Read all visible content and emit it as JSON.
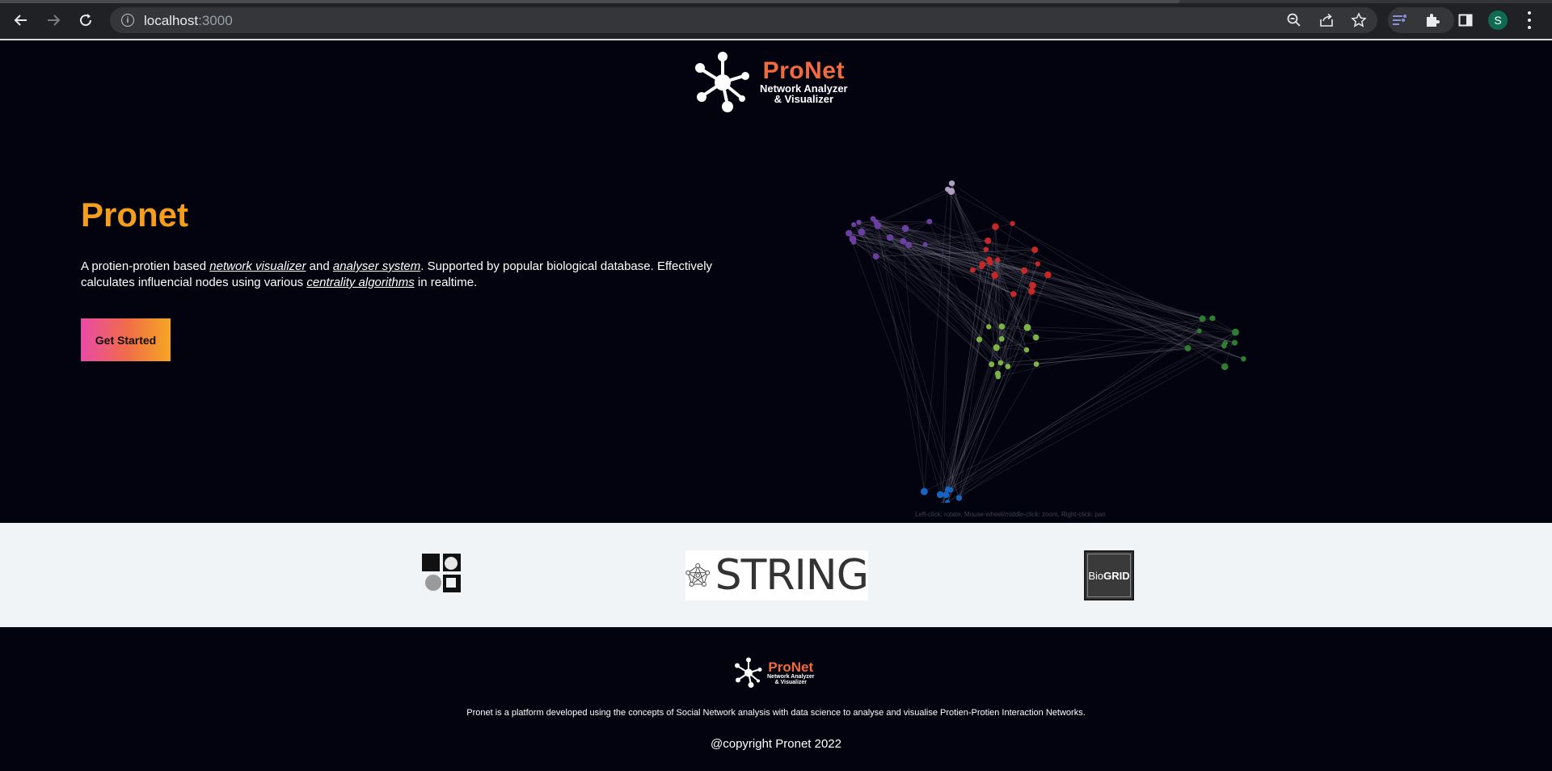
{
  "browser": {
    "url_host": "localhost",
    "url_port": ":3000",
    "profile_initial": "S",
    "icons": {
      "back": "arrow-left-icon",
      "forward": "arrow-right-icon",
      "reload": "reload-icon",
      "site_info": "info-icon",
      "zoom": "zoom-icon",
      "share": "share-icon",
      "bookmark": "star-icon",
      "extension_media": "media-controls-icon",
      "extensions": "puzzle-icon",
      "side_panel": "side-panel-icon",
      "menu": "kebab-menu-icon"
    }
  },
  "brand": {
    "name": "ProNet",
    "tagline_line1": "Network Analyzer",
    "tagline_line2": "& Visualizer",
    "logo_icon": "molecule-network-icon",
    "accent_color": "#f26a3d"
  },
  "hero": {
    "title": "Pronet",
    "text_part1": "A protien-protien based ",
    "link1": "network visualizer",
    "text_part2": " and ",
    "link2": "analyser system",
    "text_part3": ". Supported by popular biological database. Effectively calculates influencial nodes using various ",
    "link3": "centrality algorithms",
    "text_part4": " in realtime.",
    "cta_label": "Get Started",
    "title_color": "#f59e1b",
    "graph_hint": "Left-click: rotate, Mouse-wheel/middle-click: zoom, Right-click: pan",
    "graph_cluster_colors": [
      "#6b3fa0",
      "#c62828",
      "#7cb342",
      "#2e7d32",
      "#1565c0",
      "#b0a0c0"
    ]
  },
  "partners": {
    "dip_icon": "dip-database-logo-icon",
    "string_label": "STRING",
    "string_icon": "string-network-icon",
    "biogrid_label_light": "Bio",
    "biogrid_label_bold": "GRID"
  },
  "footer": {
    "brand": "ProNet",
    "tagline_line1": "Network Analyzer",
    "tagline_line2": "& Visualizer",
    "description": "Pronet is a platform developed using the concepts of Social Network analysis with data science to analyse and visualise Protien-Protien Interaction Networks.",
    "copyright": "@copyright Pronet 2022"
  }
}
